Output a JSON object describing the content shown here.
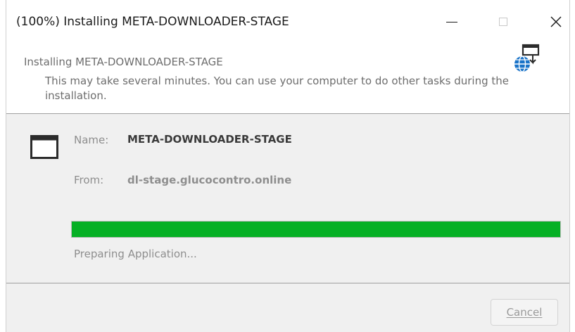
{
  "window": {
    "title": "(100%) Installing META-DOWNLOADER-STAGE"
  },
  "header": {
    "title": "Installing META-DOWNLOADER-STAGE",
    "description": "This may take several minutes. You can use your computer to do other tasks during the installation.",
    "icon": "globe-network-icon"
  },
  "details": {
    "name_label": "Name:",
    "name_value": "META-DOWNLOADER-STAGE",
    "from_label": "From:",
    "from_value": "dl-stage.glucocontro.online",
    "app_icon": "application-window-icon"
  },
  "progress": {
    "value": 1.0,
    "color": "#06b025",
    "status": "Preparing Application..."
  },
  "footer": {
    "cancel_label": "Cancel"
  },
  "colors": {
    "content_bg": "#f0f0f0",
    "progress_green": "#06b025",
    "globe_blue": "#1a73c8"
  }
}
